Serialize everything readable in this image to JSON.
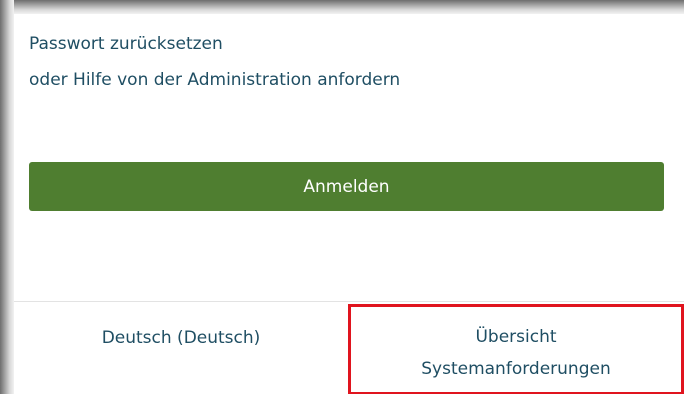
{
  "links": {
    "reset_password": "Passwort zurücksetzen",
    "request_help": "oder Hilfe von der Administration anfordern"
  },
  "login": {
    "button_label": "Anmelden"
  },
  "footer": {
    "language": "Deutsch (Deutsch)",
    "system_requirements_line1": "Übersicht",
    "system_requirements_line2": "Systemanforderungen"
  },
  "colors": {
    "primary_button": "#4f7e30",
    "link_text": "#1f4e63",
    "highlight_border": "#e0141e"
  }
}
